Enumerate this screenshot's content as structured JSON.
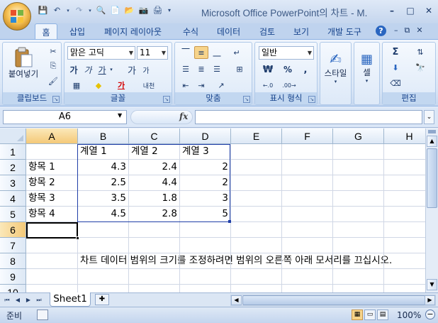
{
  "window": {
    "title": "Microsoft Office PowerPoint의 차트 - M."
  },
  "tabs": [
    "홈",
    "삽입",
    "페이지 레이아웃",
    "수식",
    "데이터",
    "검토",
    "보기",
    "개발 도구"
  ],
  "ribbon": {
    "clipboard": {
      "label": "클립보드",
      "paste": "붙여넣기"
    },
    "font": {
      "label": "글꼴",
      "name": "맑은 고딕",
      "size": "11",
      "bold": "가",
      "italic": "가",
      "underline": "가",
      "grow": "가",
      "shrink": "가",
      "phonetic": "내천"
    },
    "alignment": {
      "label": "맞춤"
    },
    "number": {
      "label": "표시 형식",
      "format": "일반",
      "currency": "₩",
      "percent": "%",
      "comma": ","
    },
    "styles": {
      "label": "스타일"
    },
    "cells": {
      "label": "셀"
    },
    "editing": {
      "label": "편집",
      "sum": "Σ"
    }
  },
  "formula_bar": {
    "name_box": "A6",
    "fx": "fx",
    "value": ""
  },
  "sheet": {
    "columns": [
      "A",
      "B",
      "C",
      "D",
      "E",
      "F",
      "G",
      "H"
    ],
    "rows": [
      "1",
      "2",
      "3",
      "4",
      "5",
      "6",
      "7",
      "8",
      "9",
      "10"
    ],
    "cells": {
      "B1": "계열 1",
      "C1": "계열 2",
      "D1": "계열 3",
      "A2": "항목 1",
      "B2": "4.3",
      "C2": "2.4",
      "D2": "2",
      "A3": "항목 2",
      "B3": "2.5",
      "C3": "4.4",
      "D3": "2",
      "A4": "항목 3",
      "B4": "3.5",
      "C4": "1.8",
      "D4": "3",
      "A5": "항목 4",
      "B5": "4.5",
      "C5": "2.8",
      "D5": "5",
      "B8": "차트 데이터 범위의 크기를 조정하려면 범위의 오른쪽 아래 모서리를 끄십시오."
    },
    "selected_cell": "A6"
  },
  "sheet_tabs": [
    "Sheet1"
  ],
  "status": {
    "ready": "준비",
    "zoom": "100%"
  }
}
